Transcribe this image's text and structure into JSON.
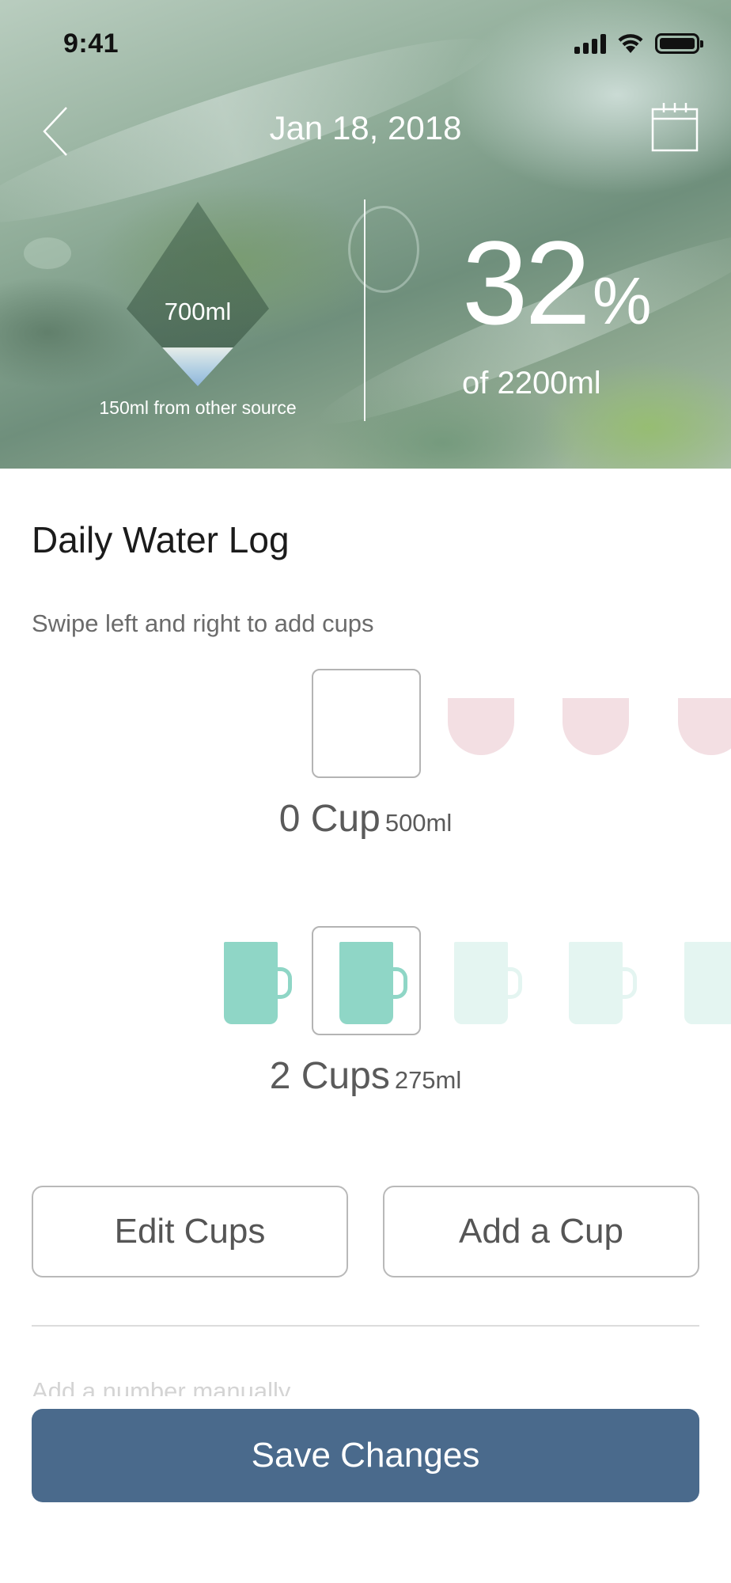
{
  "status_bar": {
    "time": "9:41"
  },
  "header": {
    "date": "Jan 18, 2018",
    "gauge_label": "700ml",
    "gauge_fill_fraction": 0.21,
    "other_source": "150ml from other source",
    "percent_value": "32",
    "percent_sign": "%",
    "of_total": "of 2200ml"
  },
  "log": {
    "title": "Daily Water Log",
    "hint": "Swipe left and right to add cups"
  },
  "row1": {
    "count_label": "0 Cup",
    "volume_label": "500ml",
    "cup_icon": "bowl-icon",
    "color": "#f3dfe3"
  },
  "row2": {
    "count_label": "2 Cups",
    "volume_label": "275ml",
    "cup_icon": "mug-icon",
    "color": "#8fd6c6",
    "faded_color": "#e4f5f1"
  },
  "buttons": {
    "edit_cups": "Edit Cups",
    "add_cup": "Add a Cup",
    "manual_hint": "Add a number manually",
    "save": "Save Changes"
  },
  "colors": {
    "accent": "#4a6a8c"
  }
}
